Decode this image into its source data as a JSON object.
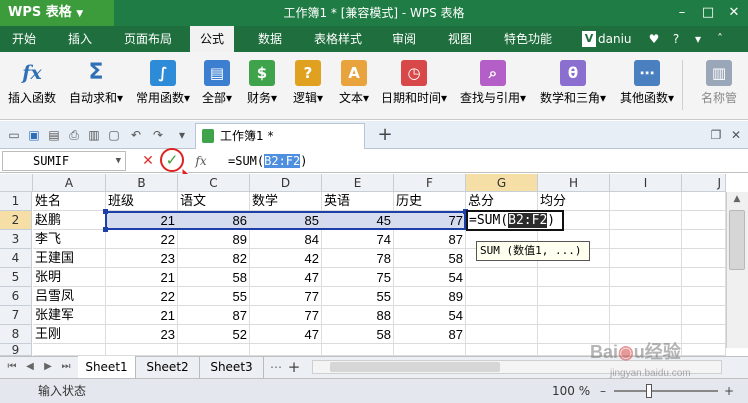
{
  "app": {
    "logo": "WPS 表格",
    "title": "工作簿1 * [兼容模式] - WPS 表格"
  },
  "window_controls": [
    "–",
    "□",
    "✕"
  ],
  "menu": [
    "开始",
    "插入",
    "页面布局",
    "公式",
    "数据",
    "表格样式",
    "审阅",
    "视图",
    "特色功能"
  ],
  "menu_active": "公式",
  "user": "daniu",
  "ribbon": [
    {
      "label": "插入函数",
      "icon": "fx-icon",
      "glyph": "fx",
      "color": "#2f6fb5"
    },
    {
      "label": "自动求和",
      "icon": "sum-icon",
      "glyph": "Σ",
      "color": "#2f6fb5"
    },
    {
      "label": "常用函数",
      "icon": "common-functions-icon",
      "glyph": "∫",
      "color": "#2e8bd8"
    },
    {
      "label": "全部",
      "icon": "all-functions-icon",
      "glyph": "▤",
      "color": "#3c7fd0"
    },
    {
      "label": "财务",
      "icon": "finance-icon",
      "glyph": "$",
      "color": "#3ea34a"
    },
    {
      "label": "逻辑",
      "icon": "logic-icon",
      "glyph": "?",
      "color": "#e0a020"
    },
    {
      "label": "文本",
      "icon": "text-icon",
      "glyph": "A",
      "color": "#e8a33c"
    },
    {
      "label": "日期和时间",
      "icon": "datetime-icon",
      "glyph": "◷",
      "color": "#d94848"
    },
    {
      "label": "查找与引用",
      "icon": "lookup-icon",
      "glyph": "⌕",
      "color": "#b45ec8"
    },
    {
      "label": "数学和三角",
      "icon": "math-icon",
      "glyph": "θ",
      "color": "#8a6fd0"
    },
    {
      "label": "其他函数",
      "icon": "other-functions-icon",
      "glyph": "⋯",
      "color": "#4a7fc0"
    },
    {
      "label": "名称管",
      "icon": "name-manager-icon",
      "glyph": "▥",
      "color": "#9aa7b8"
    }
  ],
  "doc_tab": "工作簿1 *",
  "formula_bar": {
    "name_box": "SUMIF",
    "formula_prefix": "=SUM(",
    "formula_range": "B2:F2",
    "formula_suffix": ")"
  },
  "columns": [
    "A",
    "B",
    "C",
    "D",
    "E",
    "F",
    "G",
    "H",
    "I",
    "J"
  ],
  "rows": [
    [
      "姓名",
      "班级",
      "语文",
      "数学",
      "英语",
      "历史",
      "总分",
      "均分"
    ],
    [
      "赵鹏",
      "21",
      "86",
      "85",
      "45",
      "77",
      "",
      ""
    ],
    [
      "李飞",
      "22",
      "89",
      "84",
      "74",
      "87",
      "",
      ""
    ],
    [
      "王建国",
      "23",
      "82",
      "42",
      "78",
      "58",
      "",
      ""
    ],
    [
      "张明",
      "21",
      "58",
      "47",
      "75",
      "54",
      "",
      ""
    ],
    [
      "吕雪凤",
      "22",
      "55",
      "77",
      "55",
      "89",
      "",
      ""
    ],
    [
      "张建军",
      "21",
      "87",
      "77",
      "88",
      "54",
      "",
      ""
    ],
    [
      "王刚",
      "23",
      "52",
      "47",
      "58",
      "87",
      "",
      ""
    ]
  ],
  "row_numbers": [
    "1",
    "2",
    "3",
    "4",
    "5",
    "6",
    "7",
    "8",
    "9"
  ],
  "edit_cell": {
    "prefix": "=SUM(",
    "range": "B2:F2",
    "suffix": ")"
  },
  "tooltip": "SUM (数值1, ...)",
  "sheets": [
    "Sheet1",
    "Sheet2",
    "Sheet3"
  ],
  "active_sheet": "Sheet1",
  "status": {
    "mode": "输入状态",
    "zoom": "100 %"
  },
  "watermark": "Baidu经验 jingyan.baidu.com"
}
